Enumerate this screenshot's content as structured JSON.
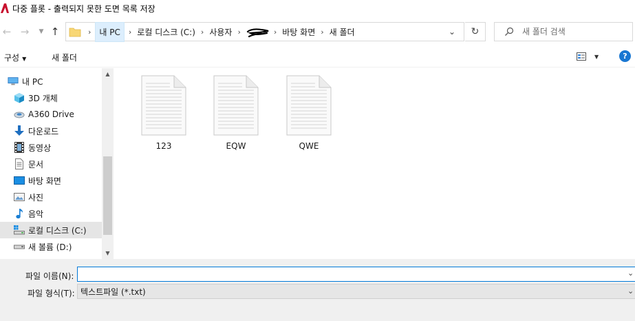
{
  "window": {
    "title": "다중 플롯 - 출력되지 못한 도면 목록 저장",
    "icon": "autocad-icon",
    "accent": "#c8102e"
  },
  "nav": {
    "back_icon": "arrow-left-icon",
    "forward_icon": "arrow-right-icon",
    "recent_icon": "chevron-down-icon",
    "up_icon": "arrow-up-icon",
    "refresh_icon": "refresh-icon",
    "breadcrumbs": [
      {
        "label": "내 PC",
        "active": true
      },
      {
        "label": "로컬 디스크 (C:)"
      },
      {
        "label": "사용자"
      },
      {
        "label": "",
        "redacted": true
      },
      {
        "label": "바탕 화면"
      },
      {
        "label": "새 폴더"
      }
    ],
    "search_placeholder": "새 폴더 검색"
  },
  "toolbar": {
    "organize_label": "구성",
    "new_folder_label": "새 폴더",
    "help_label": "?",
    "help_color": "#1977d2"
  },
  "sidebar": {
    "items": [
      {
        "label": "내 PC",
        "icon": "pc-icon",
        "level": 0
      },
      {
        "label": "3D 개체",
        "icon": "cube-icon",
        "level": 1
      },
      {
        "label": "A360 Drive",
        "icon": "cloud-drive-icon",
        "level": 1
      },
      {
        "label": "다운로드",
        "icon": "download-icon",
        "level": 1
      },
      {
        "label": "동영상",
        "icon": "video-icon",
        "level": 1
      },
      {
        "label": "문서",
        "icon": "document-icon",
        "level": 1
      },
      {
        "label": "바탕 화면",
        "icon": "desktop-icon",
        "level": 1
      },
      {
        "label": "사진",
        "icon": "pictures-icon",
        "level": 1
      },
      {
        "label": "음악",
        "icon": "music-icon",
        "level": 1
      },
      {
        "label": "로컬 디스크 (C:)",
        "icon": "drive-windows-icon",
        "level": 1,
        "selected": true
      },
      {
        "label": "새 볼륨 (D:)",
        "icon": "drive-icon",
        "level": 1
      }
    ]
  },
  "files": [
    {
      "name": "123",
      "icon": "text-file-icon"
    },
    {
      "name": "EQW",
      "icon": "text-file-icon"
    },
    {
      "name": "QWE",
      "icon": "text-file-icon"
    }
  ],
  "bottom": {
    "filename_label": "파일 이름(N):",
    "filename_value": "",
    "filetype_label": "파일 형식(T):",
    "filetype_value": "텍스트파일 (*.txt)"
  }
}
